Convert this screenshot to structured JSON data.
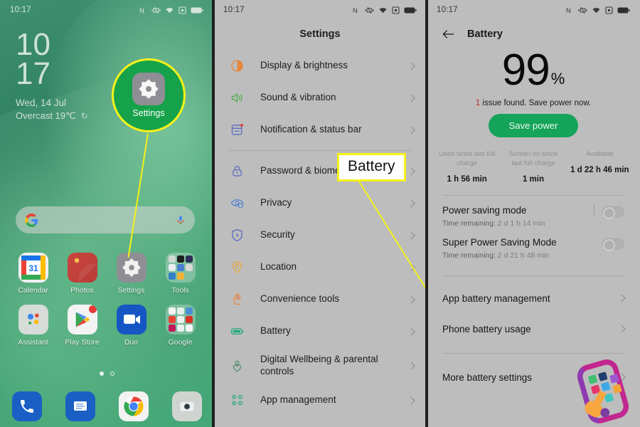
{
  "statusbar": {
    "time": "10:17",
    "icons": [
      "nfc-icon",
      "vibrate-icon",
      "wifi-icon",
      "screen-record-icon",
      "battery-icon"
    ]
  },
  "home": {
    "clock": {
      "hours": "10",
      "minutes": "17"
    },
    "date": "Wed, 14 Jul",
    "weather": "Overcast 19℃",
    "refresh_glyph": "↻",
    "search": {
      "placeholder": "",
      "left_icon": "google-g-icon",
      "right_icon": "microphone-icon"
    },
    "apps": [
      {
        "label": "Calendar",
        "icon": "calendar-icon"
      },
      {
        "label": "Photos",
        "icon": "photos-icon"
      },
      {
        "label": "Settings",
        "icon": "settings-icon"
      },
      {
        "label": "Tools",
        "icon": "tools-folder-icon"
      },
      {
        "label": "Assistant",
        "icon": "assistant-icon"
      },
      {
        "label": "Play Store",
        "icon": "play-store-icon"
      },
      {
        "label": "Duo",
        "icon": "duo-icon"
      },
      {
        "label": "Google",
        "icon": "google-folder-icon"
      }
    ],
    "dock": [
      {
        "label": "Phone",
        "icon": "phone-icon"
      },
      {
        "label": "Messages",
        "icon": "messages-icon"
      },
      {
        "label": "Chrome",
        "icon": "chrome-icon"
      },
      {
        "label": "Camera",
        "icon": "camera-icon"
      }
    ],
    "page_dots": 2,
    "active_page": 1,
    "highlight": {
      "label": "Settings",
      "ring_color": "#f5f11a",
      "fill_color": "#15a24a"
    }
  },
  "settings": {
    "title": "Settings",
    "items": [
      {
        "label": "Display & brightness",
        "icon": "brightness-icon",
        "color": "#e8863a"
      },
      {
        "label": "Sound & vibration",
        "icon": "speaker-icon",
        "color": "#4caf50"
      },
      {
        "label": "Notification & status bar",
        "icon": "notification-icon",
        "color": "#5b6bc0"
      },
      {
        "label": "Password & biometrics",
        "icon": "lock-icon",
        "color": "#5b6bc0"
      },
      {
        "label": "Privacy",
        "icon": "privacy-eye-icon",
        "color": "#4a7fd4"
      },
      {
        "label": "Security",
        "icon": "shield-icon",
        "color": "#5b6bc0"
      },
      {
        "label": "Location",
        "icon": "location-pin-icon",
        "color": "#e8a33a"
      },
      {
        "label": "Convenience tools",
        "icon": "convenience-head-icon",
        "color": "#e8863a"
      },
      {
        "label": "Battery",
        "icon": "battery-icon",
        "color": "#1faa7a"
      },
      {
        "label": "Digital Wellbeing & parental controls",
        "icon": "wellbeing-icon",
        "color": "#4a8a6a"
      },
      {
        "label": "App management",
        "icon": "app-management-icon",
        "color": "#1faa7a"
      }
    ],
    "callout_label": "Battery"
  },
  "battery": {
    "header_title": "Battery",
    "percent": "99",
    "percent_sign": "%",
    "issue_count": "1",
    "issue_text": " issue found. Save power now.",
    "save_power_label": "Save power",
    "stats": [
      {
        "label": "Used since last full charge",
        "value": "1 h 56 min"
      },
      {
        "label": "Screen on since last full charge",
        "value": "1 min"
      },
      {
        "label": "Available",
        "value": "1 d 22 h 46 min"
      }
    ],
    "modes": [
      {
        "title": "Power saving mode",
        "sub_label": "Time remaining:",
        "sub_value": "2 d 1 h 14 min",
        "toggle": "off"
      },
      {
        "title": "Super Power Saving Mode",
        "sub_label": "Time remaining:",
        "sub_value": "2 d 21 h 48 min",
        "toggle": "off"
      }
    ],
    "links": [
      {
        "label": "App battery management"
      },
      {
        "label": "Phone battery usage"
      },
      {
        "label": "More battery settings"
      }
    ]
  },
  "colors": {
    "accent_green": "#16a35a",
    "highlight_yellow": "#f5f11a",
    "issue_red": "#c62828",
    "panel_gray": "#bdbdbd"
  }
}
